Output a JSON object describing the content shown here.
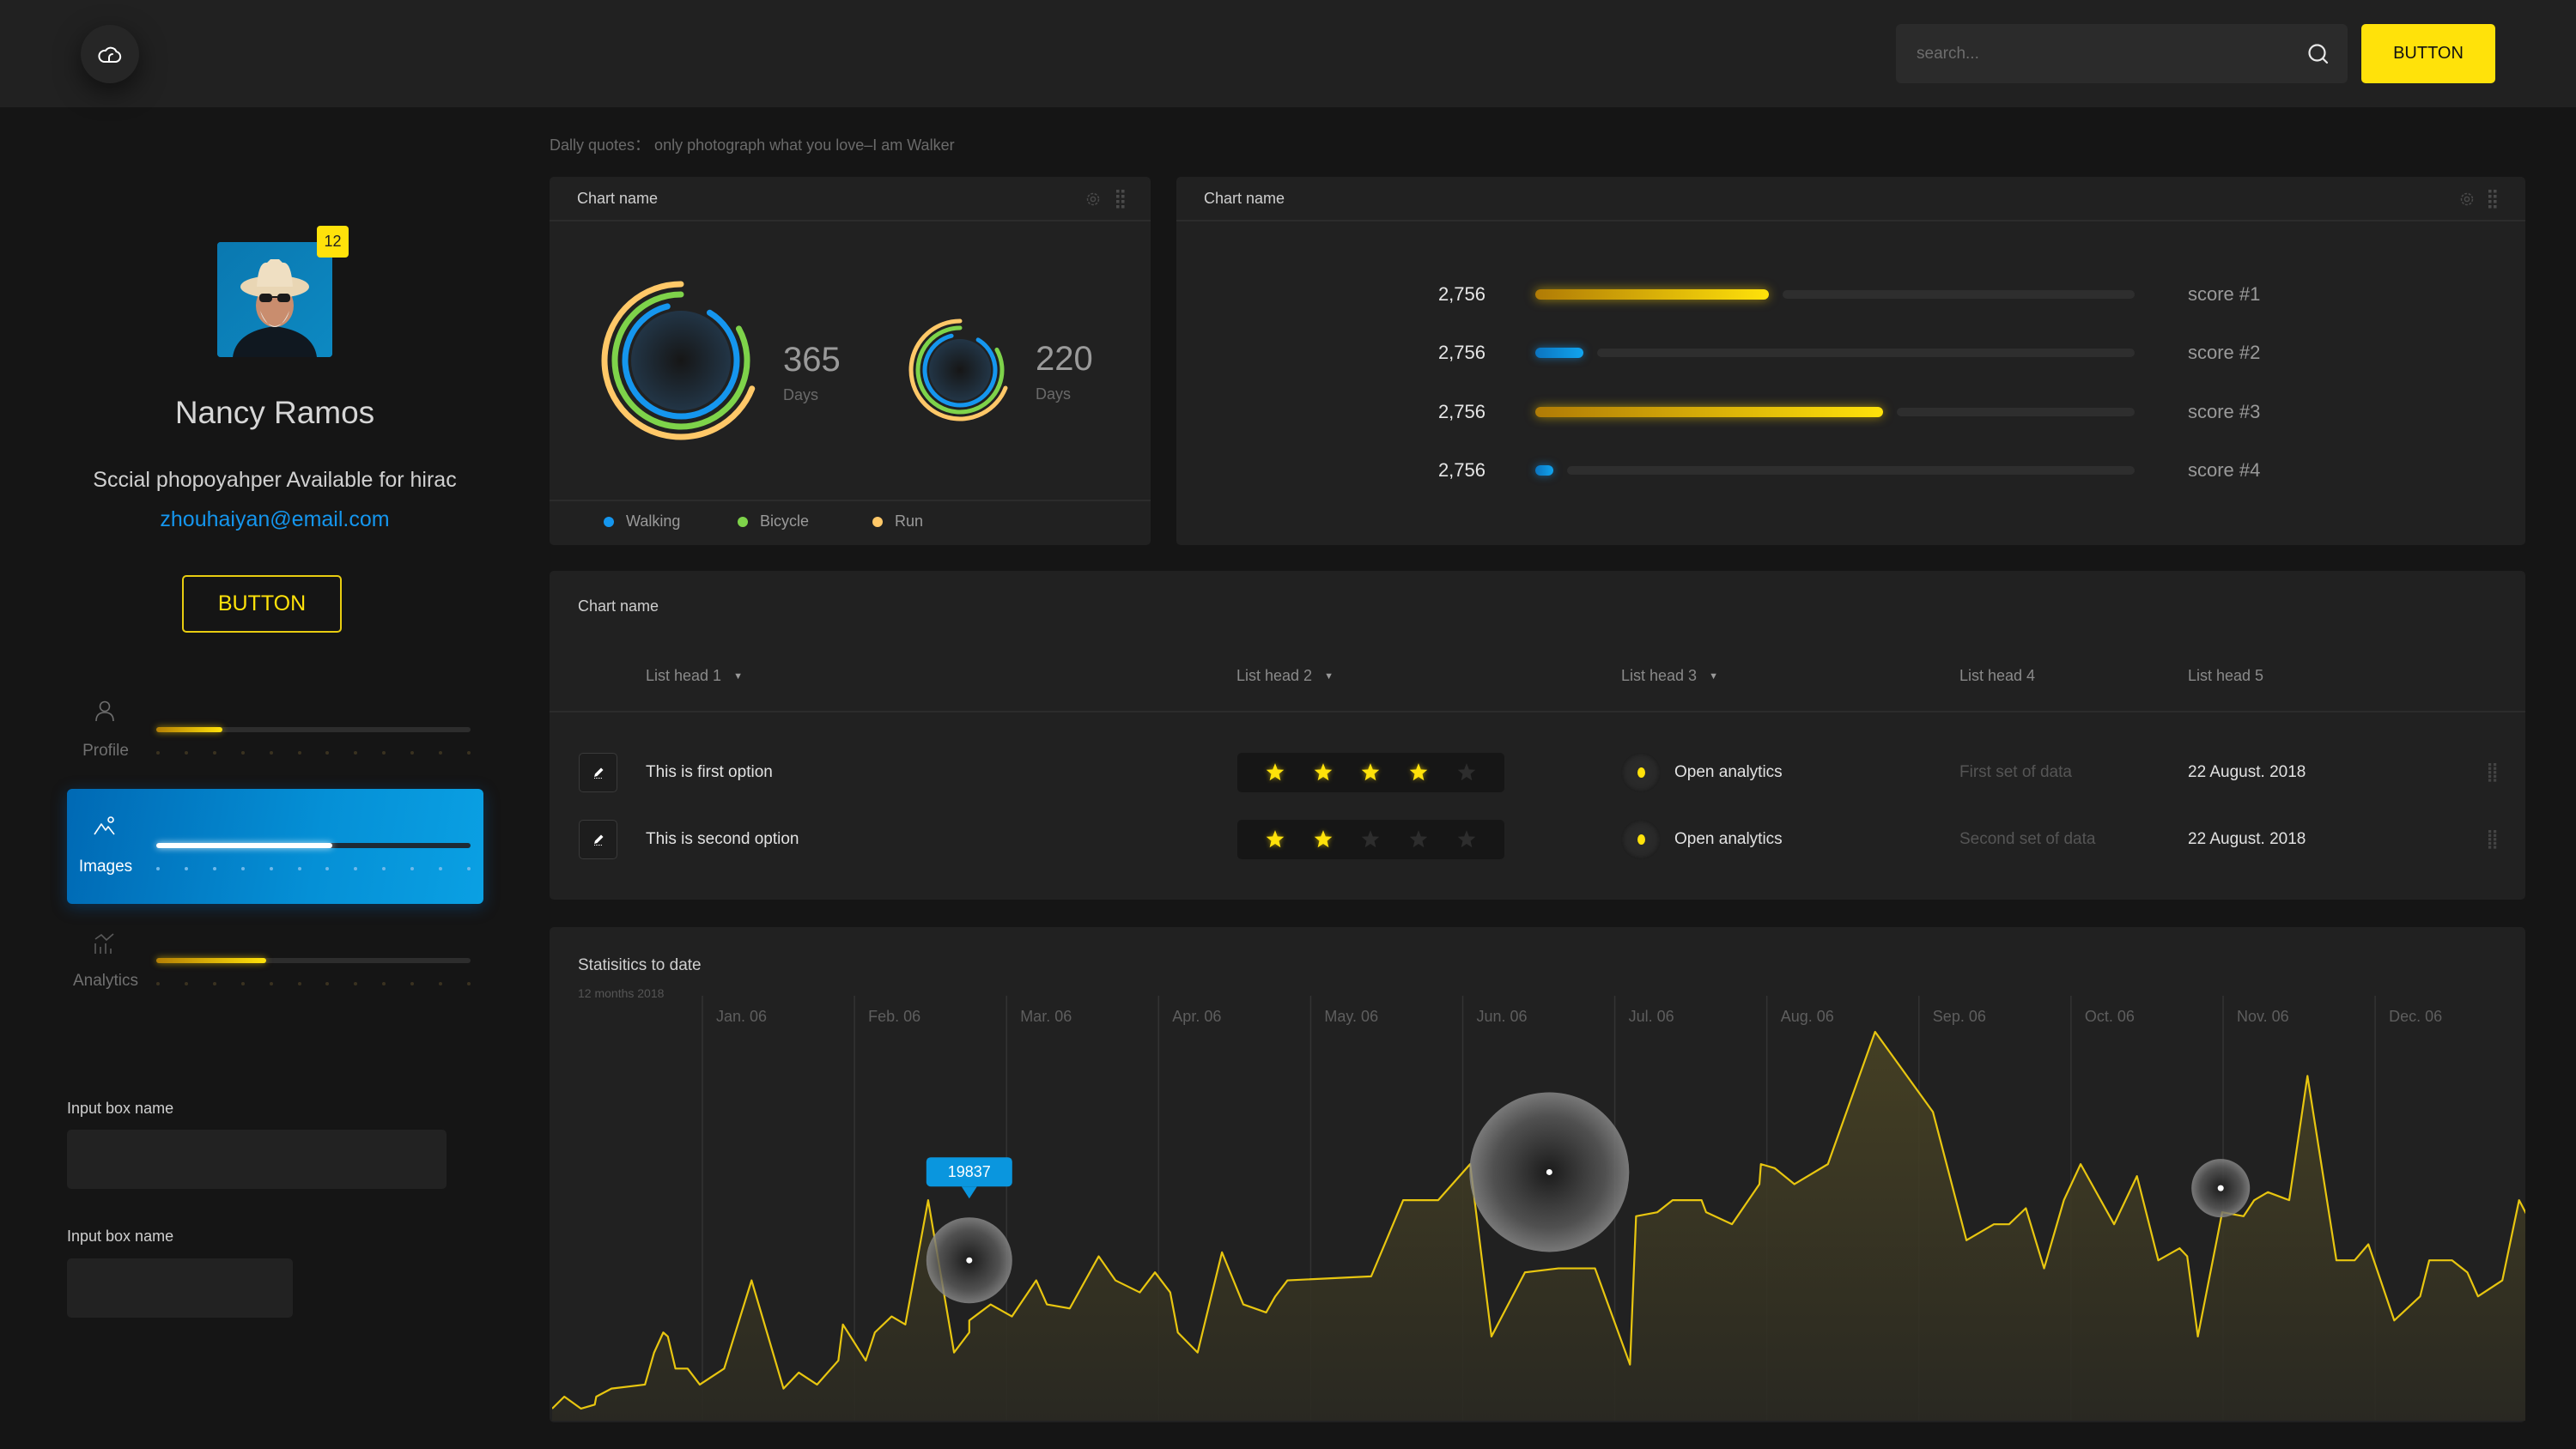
{
  "header": {
    "logo_icon": "cloud-icon",
    "search_placeholder": "search...",
    "search_value": "",
    "button_label": "BUTTON"
  },
  "quote": "Dally quotes： only photograph what you love–I am Walker",
  "profile": {
    "badge_count": "12",
    "name": "Nancy Ramos",
    "bio": "Sccial phopoyahper Available for hirac",
    "email": "zhouhaiyan@email.com",
    "button_label": "BUTTON"
  },
  "nav": [
    {
      "label": "Profile",
      "icon": "user-icon",
      "progress": 0.21,
      "active": false
    },
    {
      "label": "Images",
      "icon": "mountain-image-icon",
      "progress": 0.56,
      "active": true
    },
    {
      "label": "Analytics",
      "icon": "bar-chart-icon",
      "progress": 0.35,
      "active": false
    }
  ],
  "inputs": [
    {
      "label": "Input box name",
      "value": "",
      "placeholder": ""
    },
    {
      "label": "Input box name",
      "value": "",
      "placeholder": ""
    }
  ],
  "colors": {
    "accent": "#ffe20a",
    "blue": "#1596ee",
    "walking": "#1596ee",
    "bicycle": "#7ed34a",
    "run": "#ffc868",
    "line": "#e8c610"
  },
  "ring_panel": {
    "title": "Chart name",
    "legend": [
      "Walking",
      "Bicycle",
      "Run"
    ],
    "rings": [
      {
        "value": "365",
        "unit": "Days",
        "walking": 0.875,
        "bicycle": 0.83,
        "run": 0.69
      },
      {
        "value": "220",
        "unit": "Days",
        "walking": 0.875,
        "bicycle": 0.83,
        "run": 0.69
      }
    ]
  },
  "score_panel": {
    "title": "Chart name",
    "rows": [
      {
        "value": "2,756",
        "label": "score  #1",
        "fraction": 0.39,
        "color": "yellow"
      },
      {
        "value": "2,756",
        "label": "score  #2",
        "fraction": 0.08,
        "color": "blue"
      },
      {
        "value": "2,756",
        "label": "score  #3",
        "fraction": 0.58,
        "color": "yellow"
      },
      {
        "value": "2,756",
        "label": "score  #4",
        "fraction": 0.03,
        "color": "blue"
      }
    ]
  },
  "table": {
    "title": "Chart name",
    "headers": [
      {
        "label": "List head 1",
        "sortable": true
      },
      {
        "label": "List head 2",
        "sortable": true
      },
      {
        "label": "List head 3",
        "sortable": true
      },
      {
        "label": "List head 4",
        "sortable": false
      },
      {
        "label": "List head 5",
        "sortable": false
      }
    ],
    "rows": [
      {
        "option": "This is first option",
        "rating": 4,
        "max_rating": 5,
        "action": "Open analytics",
        "data": "First set of data",
        "date": "22 August. 2018"
      },
      {
        "option": "This is second option",
        "rating": 2,
        "max_rating": 5,
        "action": "Open analytics",
        "data": "Second set of data",
        "date": "22 August. 2018"
      }
    ]
  },
  "chart_data": {
    "type": "area",
    "title": "Statisitics to date",
    "subtitle": "12 months 2018",
    "xlabel": "",
    "ylabel": "",
    "categories": [
      "Jan. 06",
      "Feb. 06",
      "Mar. 06",
      "Apr. 06",
      "May. 06",
      "Jun. 06",
      "Jul. 06",
      "Aug. 06",
      "Sep. 06",
      "Oct. 06",
      "Nov. 06",
      "Dec. 06"
    ],
    "x_range": [
      0,
      12.85
    ],
    "y_range": [
      0,
      100
    ],
    "grid": "vertical",
    "series": [
      {
        "name": "statistics",
        "points": [
          [
            0.0,
            3
          ],
          [
            0.08,
            6
          ],
          [
            0.19,
            3
          ],
          [
            0.28,
            4
          ],
          [
            0.29,
            6
          ],
          [
            0.39,
            8
          ],
          [
            0.61,
            9
          ],
          [
            0.67,
            17
          ],
          [
            0.73,
            22
          ],
          [
            0.76,
            21
          ],
          [
            0.81,
            13
          ],
          [
            0.89,
            13
          ],
          [
            0.97,
            9
          ],
          [
            1.13,
            13
          ],
          [
            1.31,
            35
          ],
          [
            1.52,
            8
          ],
          [
            1.62,
            12
          ],
          [
            1.74,
            9
          ],
          [
            1.88,
            15
          ],
          [
            1.91,
            24
          ],
          [
            2.06,
            15
          ],
          [
            2.12,
            22
          ],
          [
            2.23,
            26
          ],
          [
            2.32,
            24
          ],
          [
            2.47,
            55
          ],
          [
            2.64,
            17
          ],
          [
            2.74,
            22
          ],
          [
            2.74,
            25
          ],
          [
            2.88,
            29
          ],
          [
            3.02,
            26
          ],
          [
            3.18,
            35
          ],
          [
            3.25,
            29
          ],
          [
            3.4,
            28
          ],
          [
            3.59,
            41
          ],
          [
            3.7,
            35
          ],
          [
            3.86,
            32
          ],
          [
            3.96,
            37
          ],
          [
            4.06,
            32
          ],
          [
            4.11,
            22
          ],
          [
            4.24,
            17
          ],
          [
            4.4,
            42
          ],
          [
            4.54,
            29
          ],
          [
            4.69,
            27
          ],
          [
            4.75,
            31
          ],
          [
            4.83,
            35
          ],
          [
            5.38,
            36
          ],
          [
            5.59,
            55
          ],
          [
            5.82,
            55
          ],
          [
            6.03,
            64
          ],
          [
            6.17,
            21
          ],
          [
            6.39,
            37
          ],
          [
            6.61,
            38
          ],
          [
            6.76,
            38
          ],
          [
            6.85,
            38
          ],
          [
            7.08,
            14
          ],
          [
            7.12,
            51
          ],
          [
            7.26,
            52
          ],
          [
            7.36,
            55
          ],
          [
            7.55,
            55
          ],
          [
            7.58,
            52
          ],
          [
            7.75,
            49
          ],
          [
            7.93,
            59
          ],
          [
            7.94,
            64
          ],
          [
            8.03,
            63
          ],
          [
            8.16,
            59
          ],
          [
            8.38,
            64
          ],
          [
            8.69,
            97
          ],
          [
            9.07,
            77
          ],
          [
            9.29,
            45
          ],
          [
            9.47,
            49
          ],
          [
            9.57,
            49
          ],
          [
            9.68,
            53
          ],
          [
            9.8,
            38
          ],
          [
            9.93,
            55
          ],
          [
            10.04,
            64
          ],
          [
            10.26,
            49
          ],
          [
            10.41,
            61
          ],
          [
            10.55,
            40
          ],
          [
            10.69,
            43
          ],
          [
            10.74,
            41
          ],
          [
            10.81,
            21
          ],
          [
            10.97,
            52
          ],
          [
            11.11,
            51
          ],
          [
            11.18,
            55
          ],
          [
            11.27,
            57
          ],
          [
            11.41,
            55
          ],
          [
            11.53,
            86
          ],
          [
            11.72,
            40
          ],
          [
            11.84,
            40
          ],
          [
            11.93,
            44
          ],
          [
            12.1,
            25
          ],
          [
            12.27,
            31
          ],
          [
            12.33,
            40
          ],
          [
            12.48,
            40
          ],
          [
            12.58,
            37
          ],
          [
            12.65,
            31
          ],
          [
            12.81,
            35
          ],
          [
            12.92,
            55
          ],
          [
            13.1,
            42
          ],
          [
            13.22,
            47
          ],
          [
            13.26,
            44
          ]
        ]
      }
    ],
    "bubbles": [
      {
        "x": 2.74,
        "y": 40,
        "size": "medium",
        "label": "19837"
      },
      {
        "x": 6.55,
        "y": 62,
        "size": "large",
        "label": ""
      },
      {
        "x": 10.96,
        "y": 58,
        "size": "small",
        "label": ""
      }
    ],
    "tooltip": {
      "value": "19837",
      "color": "#0a96de"
    }
  }
}
